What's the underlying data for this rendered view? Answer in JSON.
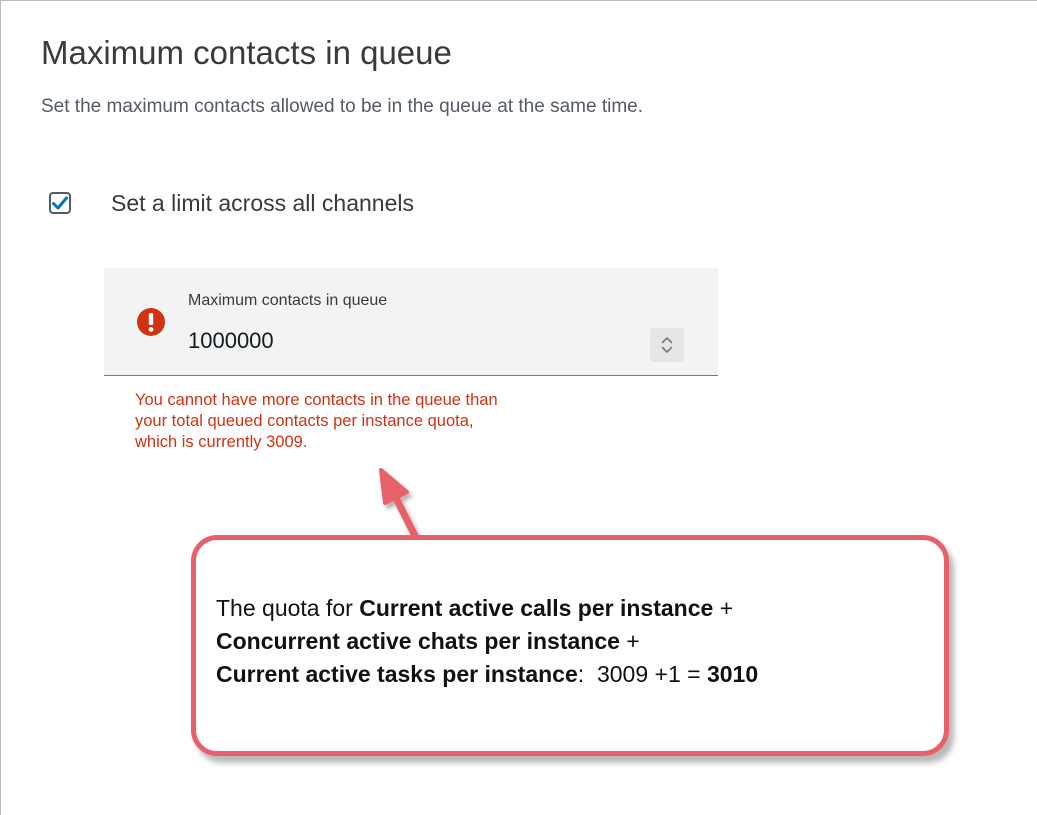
{
  "section": {
    "title": "Maximum contacts in queue",
    "description": "Set the maximum contacts allowed to be in the queue at the same time."
  },
  "limit_checkbox": {
    "label": "Set a limit across all channels",
    "checked": true
  },
  "max_contacts_field": {
    "label": "Maximum contacts in queue",
    "value": "1000000",
    "error": {
      "line1": "You cannot have more contacts in the queue than",
      "line2": "your total queued contacts per instance quota,",
      "line3": "which is currently 3009."
    }
  },
  "callout": {
    "prefix": "The quota for ",
    "term1": "Current active calls per instance",
    "plus1": " +",
    "term2": "Concurrent active chats per instance",
    "plus2": " +",
    "term3": "Current active tasks per instance",
    "colon": ":",
    "equation": "3009 +1 = ",
    "result": "3010"
  },
  "colors": {
    "error": "#d13212",
    "checkbox_check": "#0073bb",
    "callout_border": "#e8616a"
  },
  "icons": {
    "checkbox": "check-icon",
    "error": "exclamation-circle-icon",
    "stepper": "chevron-up-down-icon",
    "arrow": "arrow-up-icon"
  }
}
